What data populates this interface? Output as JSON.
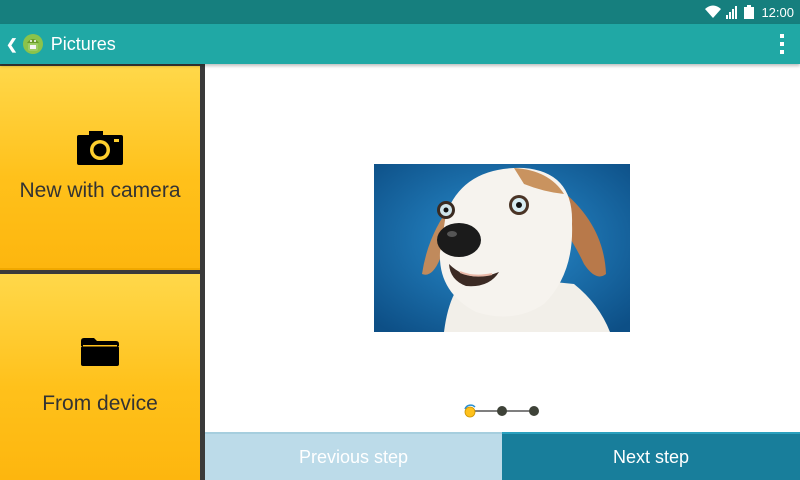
{
  "status_bar": {
    "time": "12:00",
    "icons": [
      "wifi-icon",
      "signal-icon",
      "battery-icon"
    ]
  },
  "action_bar": {
    "title": "Pictures",
    "back_icon": "chevron-left-icon",
    "app_icon": "android-app-icon",
    "menu_icon": "overflow-menu-icon"
  },
  "sources": [
    {
      "label": "New with camera",
      "icon": "camera-icon"
    },
    {
      "label": "From device",
      "icon": "folder-icon"
    }
  ],
  "preview": {
    "image": "dog-photo"
  },
  "steps": {
    "total": 3,
    "current": 1
  },
  "footer": {
    "previous_label": "Previous step",
    "next_label": "Next step"
  },
  "colors": {
    "status_bar": "#167f7e",
    "action_bar": "#20a8a5",
    "tile_yellow": "#ffc11b",
    "previous_button": "#bcdbe9",
    "next_button": "#187e9b"
  }
}
